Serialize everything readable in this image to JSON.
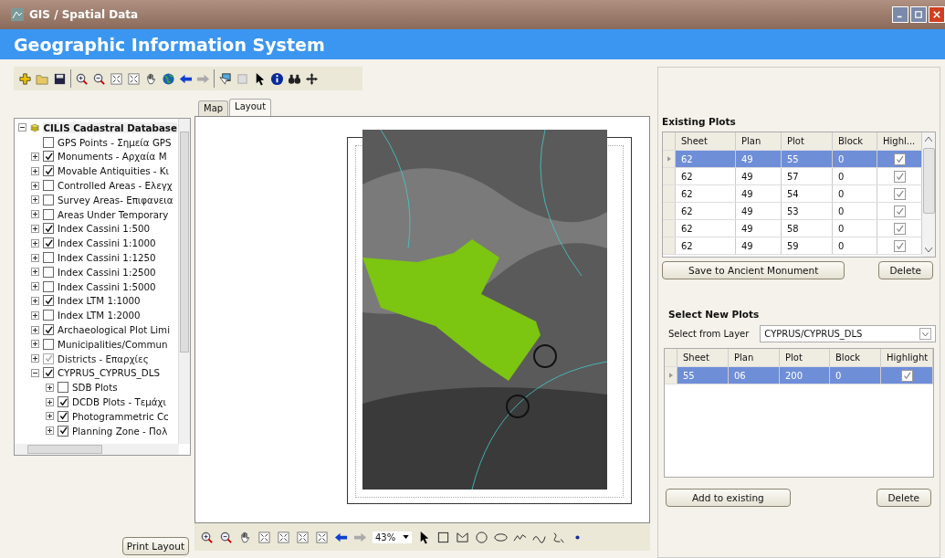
{
  "window": {
    "title": "GIS / Spatial Data"
  },
  "header": {
    "title": "Geographic Information System"
  },
  "tabs": [
    {
      "label": "Map",
      "selected": false
    },
    {
      "label": "Layout",
      "selected": true
    }
  ],
  "layer_tree": {
    "label": "CILIS Cadastral Database",
    "expanded": true,
    "children": [
      {
        "label": "GPS Points - Σημεία GPS",
        "checked": false,
        "disabled": false
      },
      {
        "label": "Monuments - Αρχαία M",
        "checked": true,
        "disabled": false,
        "expanded": false
      },
      {
        "label": "Movable Antiquities - Κι",
        "checked": true,
        "disabled": false,
        "expanded": false
      },
      {
        "label": "Controlled Areas - Ελεγχ",
        "checked": false,
        "disabled": false,
        "expanded": false
      },
      {
        "label": "Survey Areas- Επιφανεια",
        "checked": false,
        "disabled": false,
        "expanded": false
      },
      {
        "label": "Areas Under Temporary",
        "checked": false,
        "disabled": false,
        "expanded": false
      },
      {
        "label": "Index Cassini 1:500",
        "checked": true,
        "disabled": false,
        "expanded": false
      },
      {
        "label": "Index Cassini 1:1000",
        "checked": true,
        "disabled": false,
        "expanded": false
      },
      {
        "label": "Index Cassini 1:1250",
        "checked": false,
        "disabled": false,
        "expanded": false
      },
      {
        "label": "Index Cassini 1:2500",
        "checked": false,
        "disabled": false,
        "expanded": false
      },
      {
        "label": "Index Cassini 1:5000",
        "checked": false,
        "disabled": false,
        "expanded": false
      },
      {
        "label": "Index LTM 1:1000",
        "checked": true,
        "disabled": false,
        "expanded": false
      },
      {
        "label": "Index LTM 1:2000",
        "checked": false,
        "disabled": false,
        "expanded": false
      },
      {
        "label": "Archaeological Plot Limi",
        "checked": true,
        "disabled": false,
        "expanded": false
      },
      {
        "label": "Municipalities/Commun",
        "checked": false,
        "disabled": false,
        "expanded": false
      },
      {
        "label": "Districts - Επαρχίες",
        "checked": true,
        "disabled": true,
        "expanded": false
      },
      {
        "label": "CYPRUS_CYPRUS_DLS",
        "checked": true,
        "disabled": false,
        "expanded": true,
        "children": [
          {
            "label": "SDB Plots",
            "checked": false,
            "disabled": false,
            "expanded": false
          },
          {
            "label": "DCDB Plots - Τεμάχι",
            "checked": true,
            "disabled": false,
            "expanded": false
          },
          {
            "label": "Photogrammetric Cc",
            "checked": true,
            "disabled": false,
            "expanded": false
          },
          {
            "label": "Planning Zone - Πολ",
            "checked": true,
            "disabled": false,
            "expanded": false
          }
        ]
      }
    ]
  },
  "print_button": "Print Layout",
  "layout_toolbar": {
    "zoom": "43%"
  },
  "existing_plots": {
    "title": "Existing Plots",
    "columns": [
      "Sheet",
      "Plan",
      "Plot",
      "Block",
      "Highl..."
    ],
    "rows": [
      {
        "cells": [
          "62",
          "49",
          "55",
          "0"
        ],
        "highlight": true,
        "selected": true
      },
      {
        "cells": [
          "62",
          "49",
          "57",
          "0"
        ],
        "highlight": true,
        "selected": false
      },
      {
        "cells": [
          "62",
          "49",
          "54",
          "0"
        ],
        "highlight": true,
        "selected": false
      },
      {
        "cells": [
          "62",
          "49",
          "53",
          "0"
        ],
        "highlight": true,
        "selected": false
      },
      {
        "cells": [
          "62",
          "49",
          "58",
          "0"
        ],
        "highlight": true,
        "selected": false
      },
      {
        "cells": [
          "62",
          "49",
          "59",
          "0"
        ],
        "highlight": true,
        "selected": false
      }
    ],
    "buttons": [
      "Save to Ancient Monument",
      "Delete"
    ]
  },
  "new_plots": {
    "title": "Select New Plots",
    "layer_label": "Select from Layer",
    "layer_value": "CYPRUS/CYPRUS_DLS",
    "columns": [
      "Sheet",
      "Plan",
      "Plot",
      "Block",
      "Highlight"
    ],
    "rows": [
      {
        "cells": [
          "55",
          "06",
          "200",
          "0"
        ],
        "highlight": true,
        "selected": true
      }
    ],
    "buttons": [
      "Add to existing",
      "Delete"
    ]
  }
}
